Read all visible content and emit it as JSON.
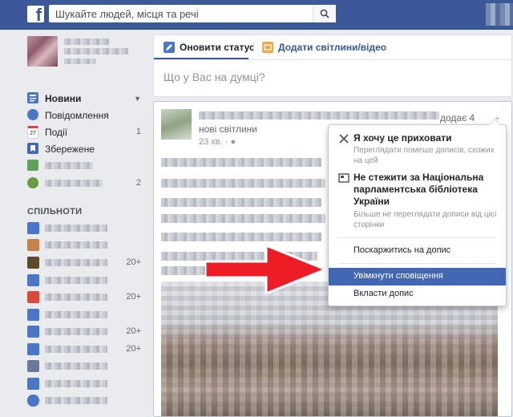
{
  "topbar": {
    "logo": "f",
    "search_placeholder": "Шукайте людей, місця та речі"
  },
  "sidebar": {
    "items": [
      {
        "label": "Новини",
        "icon": "news-feed-icon",
        "bold": true
      },
      {
        "label": "Повідомлення",
        "icon": "messages-icon"
      },
      {
        "label": "Події",
        "icon": "calendar-icon",
        "count": "1"
      },
      {
        "label": "Збережене",
        "icon": "bookmark-icon"
      }
    ],
    "section_title": "СПІЛЬНОТИ",
    "group_counts": [
      "",
      "",
      "20+",
      "",
      "20+",
      "",
      "20+",
      "20+",
      "",
      ""
    ],
    "pages_count": "2"
  },
  "composer": {
    "tab_status": "Оновити статус",
    "tab_photo": "Додати світлини/відео",
    "placeholder": "Що у Вас на думці?"
  },
  "post": {
    "added_text": "додає 4",
    "new_photos": "нові світлини",
    "time": "23 хв. ·"
  },
  "menu": {
    "hide_title": "Я хочу це приховати",
    "hide_sub": "Переглядати помеше дописів, схожих на цей",
    "unfollow_title": "Не стежити за Національна парламентська бібліотека України",
    "unfollow_sub": "Більше не переглядати дописи від цієї сторінки",
    "report": "Поскаржитись на допис",
    "notify": "Увімкнути сповіщення",
    "embed": "Вкласти допис"
  },
  "colors": {
    "brand": "#3b5998",
    "highlight": "#4267b2",
    "arrow": "#ee1c25"
  }
}
